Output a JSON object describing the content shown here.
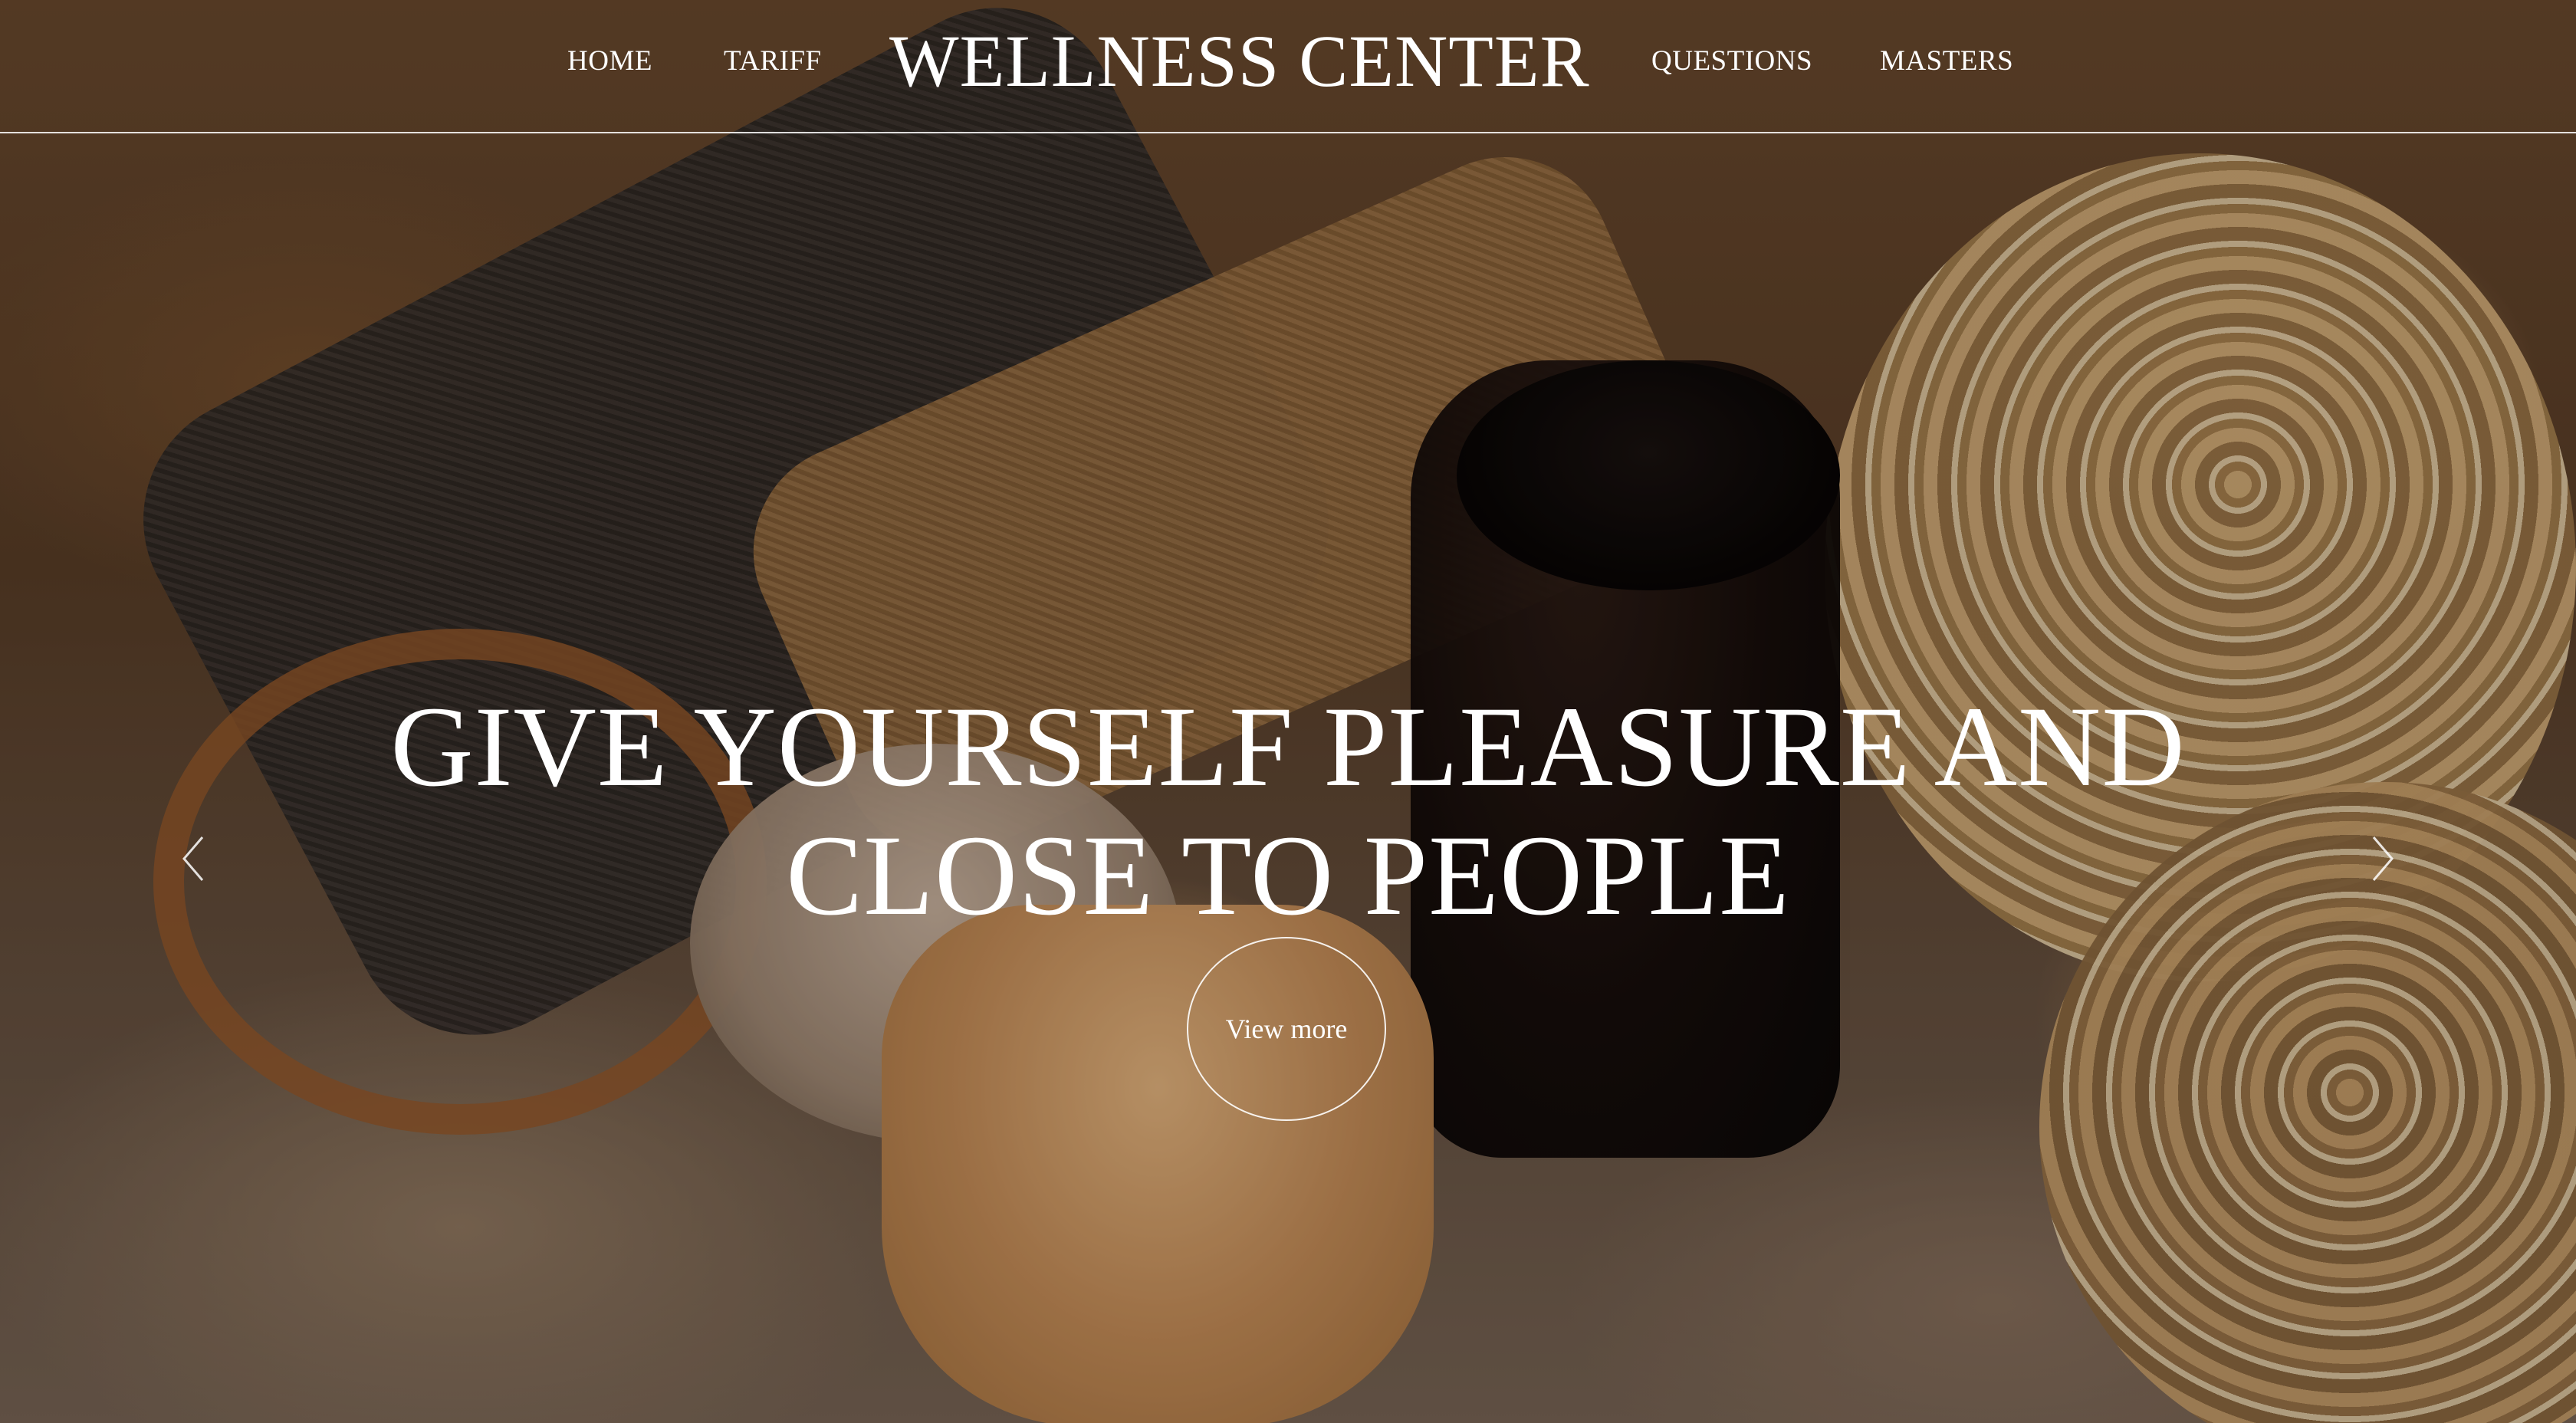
{
  "nav": {
    "home": "HOME",
    "tariff": "TARIFF",
    "brand": "WELLNESS CENTER",
    "questions": "QUESTIONS",
    "masters": "MASTERS"
  },
  "hero": {
    "headline_line1": "GIVE YOURSELF PLEASURE AND",
    "headline_line2": "CLOSE TO PEOPLE",
    "button_label": "View more"
  },
  "carousel": {
    "prev_icon": "chevron-left-icon",
    "next_icon": "chevron-right-icon"
  },
  "colors": {
    "text": "#ffffff",
    "divider": "#ffffff"
  }
}
